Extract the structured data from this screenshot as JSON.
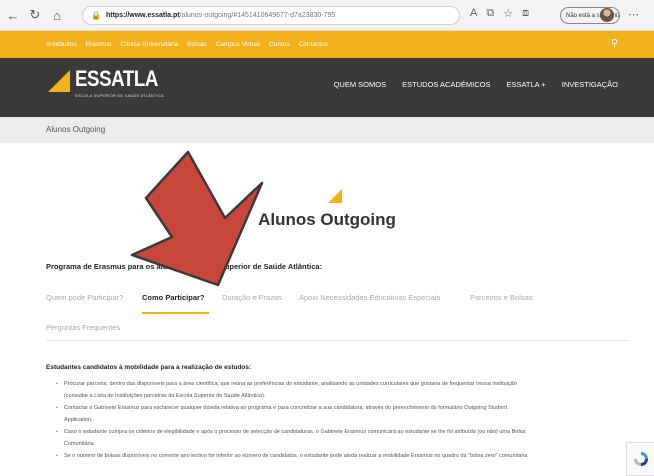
{
  "browser": {
    "url_host": "https://www.essatla.pt",
    "url_path": "/alunos-outgoing/#1451410649677-d7a23830-795",
    "sync_label": "Não está a sincronizar"
  },
  "top_links": [
    "Antebuitos",
    "Erasmus",
    "Clínica Universitária",
    "Bolsas",
    "Campus Virtual",
    "Cursos",
    "Contactos"
  ],
  "header": {
    "logo_text": "ESSATLA",
    "logo_sub": "ESCOLA SUPERIOR DE SAÚDE ATLÂNTICA",
    "nav": [
      "QUEM SOMOS",
      "ESTUDOS ACADÉMICOS",
      "ESSATLA +",
      "INVESTIGAÇÃO"
    ]
  },
  "breadcrumb": "Alunos Outgoing",
  "page_title": "Alunos Outgoing",
  "program_heading": "Programa de Erasmus para os alunos da Escola Superior de Saúde Atlântica:",
  "tabs": [
    "Quem pode Participar?",
    "Como Participar?",
    "Duração e Prazos",
    "Apoio Necessidades Educativas Especiais",
    "Parceiros e Bolsas",
    "Perguntas Frequentes"
  ],
  "active_tab": "Como Participar?",
  "section_heading": "Estudantes candidatos à mobilidade para a realização de estudos:",
  "bullets": [
    "Procurar parceria, dentro das disponíveis para a área científica, que reúna as preferências do estudante, analisando as unidades curriculares que gostaria de frequentar nessa instituição",
    "(consultar a Lista de Instituições parceiras da Escola Superior de Saúde Atlântica).",
    "Contactar o Gabinete Erasmus para esclarecer qualquer dúvida relativa ao programa e para concretizar a sua candidatura, através do preenchimento do formulário Outgoing Student",
    "Application.",
    "Caso o estudante cumpra os critérios de elegibilidade e após o processo de selecção de candidaturas, o Gabinete Erasmus comunicará ao estudante se lhe foi atribuída (ou não) uma Bolsa",
    "Comunitária.",
    "Se o número de bolsas disponíveis no corrente ano lectivo for inferior ao número de candidatos, o estudante pode ainda realizar a mobilidade Erasmus no quadro da \"bolsa zero\" comunitária"
  ],
  "colors": {
    "accent": "#f2b21b",
    "header_bg": "#3a3a3a",
    "annotation_arrow": "#c8473a"
  }
}
